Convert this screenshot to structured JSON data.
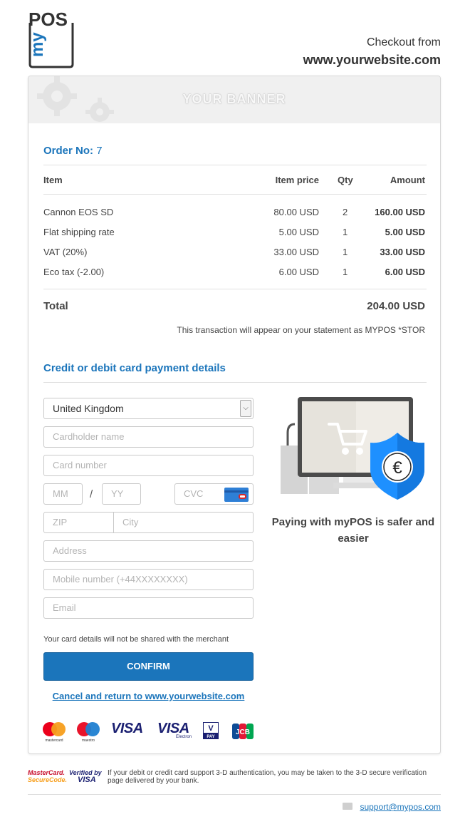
{
  "logo": {
    "text_top": "POS",
    "text_side": "my"
  },
  "header": {
    "checkout_from": "Checkout from",
    "site": "www.yourwebsite.com"
  },
  "banner": {
    "text": "YOUR BANNER"
  },
  "order": {
    "label": "Order No:",
    "number": "7",
    "columns": {
      "item": "Item",
      "price": "Item price",
      "qty": "Qty",
      "amount": "Amount"
    },
    "rows": [
      {
        "item": "Cannon EOS SD",
        "price": "80.00 USD",
        "qty": "2",
        "amount": "160.00 USD"
      },
      {
        "item": "Flat shipping rate",
        "price": "5.00 USD",
        "qty": "1",
        "amount": "5.00 USD"
      },
      {
        "item": "VAT (20%)",
        "price": "33.00 USD",
        "qty": "1",
        "amount": "33.00 USD"
      },
      {
        "item": "Eco tax (-2.00)",
        "price": "6.00 USD",
        "qty": "1",
        "amount": "6.00 USD"
      }
    ],
    "total_label": "Total",
    "total_value": "204.00 USD",
    "statement": "This transaction will appear on your statement as MYPOS  *STOR"
  },
  "payment": {
    "title": "Credit or debit card payment details",
    "country": "United Kingdom",
    "cardholder_placeholder": "Cardholder name",
    "card_number_placeholder": "Card number",
    "mm_placeholder": "MM",
    "slash": "/",
    "yy_placeholder": "YY",
    "cvc_placeholder": "CVC",
    "zip_placeholder": "ZIP",
    "city_placeholder": "City",
    "address_placeholder": "Address",
    "mobile_placeholder": "Mobile number (+44XXXXXXXX)",
    "email_placeholder": "Email",
    "note": "Your card details will not be shared with the merchant",
    "confirm_label": "CONFIRM",
    "cancel_label": "Cancel and return to www.yourwebsite.com",
    "safe_text": "Paying with myPOS is safer and easier",
    "euro_symbol": "€",
    "brands": {
      "mastercard": "mastercard",
      "maestro": "maestro",
      "visa": "VISA",
      "visa_electron": "VISA",
      "electron": "Electron",
      "vpay_v": "V",
      "vpay_pay": "PAY",
      "jcb": "JCB"
    }
  },
  "footer": {
    "mc_line1": "MasterCard.",
    "mc_line2": "SecureCode.",
    "vbv_line1": "Verified by",
    "vbv_line2": "VISA",
    "text": "If your debit or credit card support 3-D authentication, you may be taken to the 3-D secure verification page delivered by your bank.",
    "support_email": "support@mypos.com"
  },
  "colors": {
    "accent": "#1b75bb",
    "shield": "#1e90ff"
  }
}
